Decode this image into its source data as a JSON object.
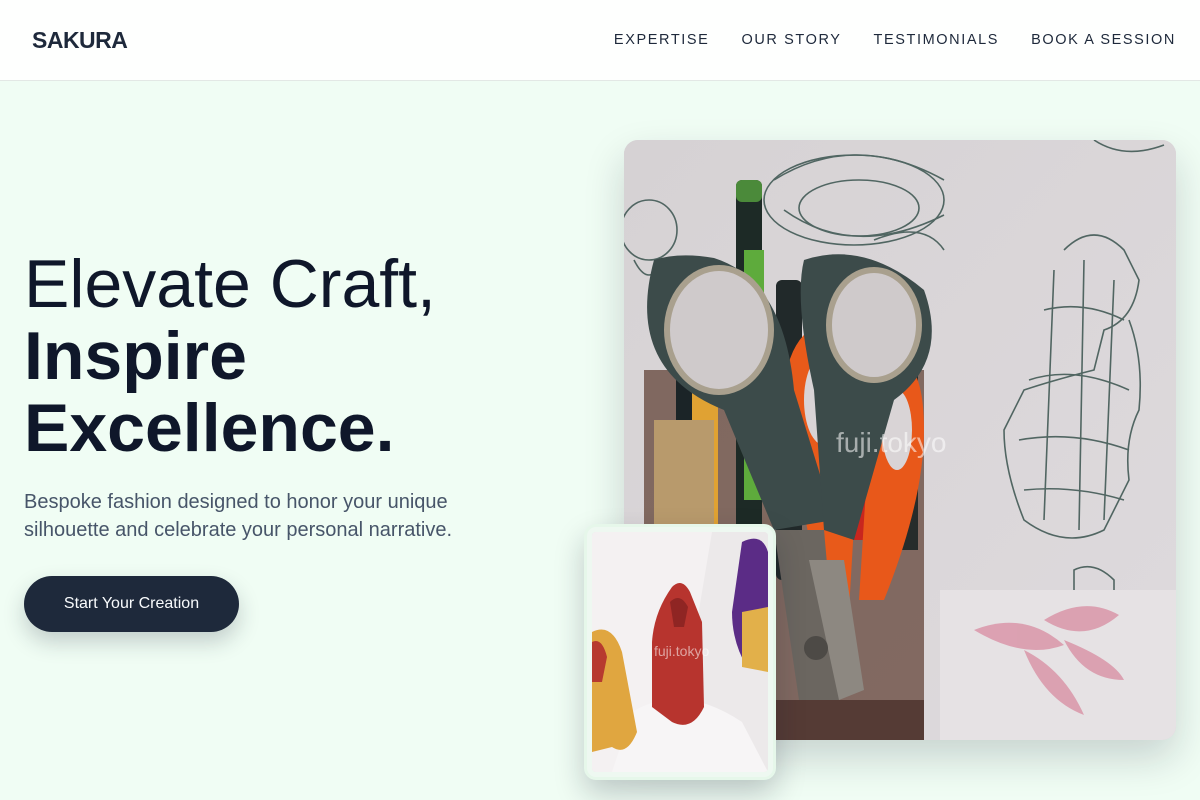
{
  "header": {
    "logo": "SAKURA",
    "nav": [
      {
        "label": "EXPERTISE"
      },
      {
        "label": "OUR STORY"
      },
      {
        "label": "TESTIMONIALS"
      },
      {
        "label": "BOOK A SESSION"
      }
    ]
  },
  "hero": {
    "title_line1": "Elevate Craft,",
    "title_line2": "Inspire",
    "title_line3": "Excellence.",
    "subtitle": "Bespoke fashion designed to honor your unique silhouette and celebrate your personal narrative.",
    "cta_label": "Start Your Creation"
  },
  "images": {
    "main_watermark": "fuji.tokyo",
    "small_watermark": "fuji.tokyo"
  },
  "colors": {
    "background": "#f0fdf4",
    "header_bg": "#fefffe",
    "primary": "#1e293b",
    "title": "#0f172a",
    "subtitle": "#475569"
  }
}
